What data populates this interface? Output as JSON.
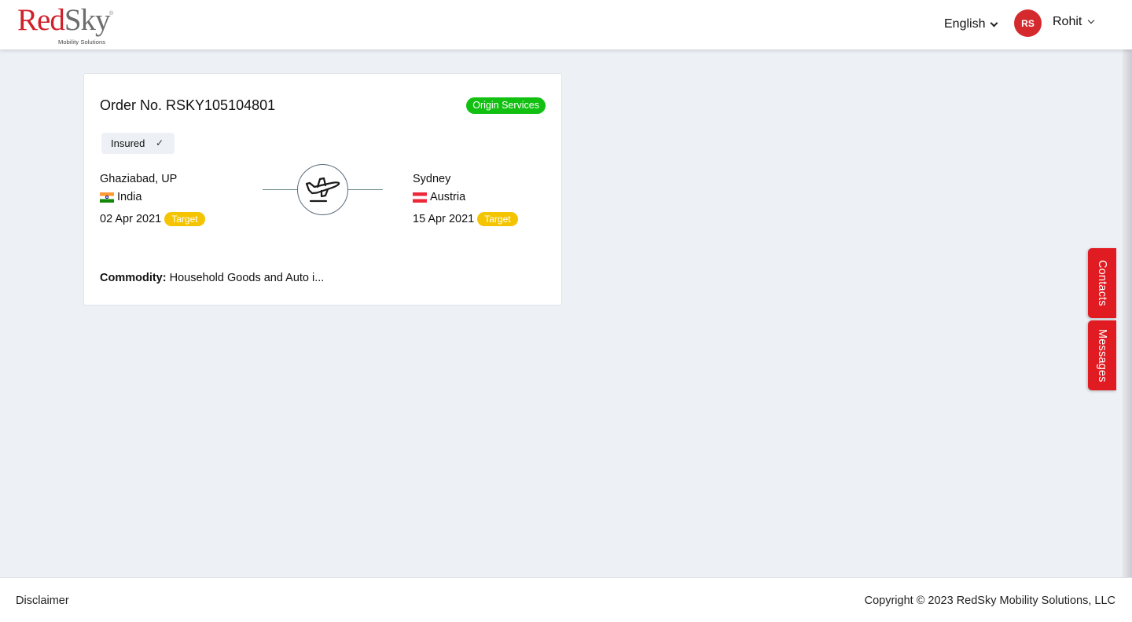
{
  "header": {
    "logo_red": "Red",
    "logo_gray": "Sky",
    "logo_reg": "®",
    "logo_tagline": "Mobility Solutions",
    "language": "English",
    "avatar_initials": "RS",
    "user_name": "Rohit"
  },
  "order": {
    "title": "Order No. RSKY105104801",
    "status": "Origin Services",
    "insured_label": "Insured",
    "insured_check": "✓",
    "origin": {
      "city": "Ghaziabad, UP",
      "country": "India",
      "date": "02 Apr 2021",
      "badge": "Target"
    },
    "destination": {
      "city": "Sydney",
      "country": "Austria",
      "date": "15 Apr 2021",
      "badge": "Target"
    },
    "commodity_label": "Commodity:",
    "commodity_value": "Household Goods and Auto i..."
  },
  "side_tabs": {
    "contacts": "Contacts",
    "messages": "Messages"
  },
  "footer": {
    "disclaimer": "Disclaimer",
    "copyright": "Copyright © 2023 RedSky Mobility Solutions, LLC"
  },
  "colors": {
    "brand_red": "#d0202a",
    "status_green": "#12c012",
    "target_yellow": "#f4c400",
    "tab_red": "#e11b22",
    "background": "#edf0f5"
  }
}
